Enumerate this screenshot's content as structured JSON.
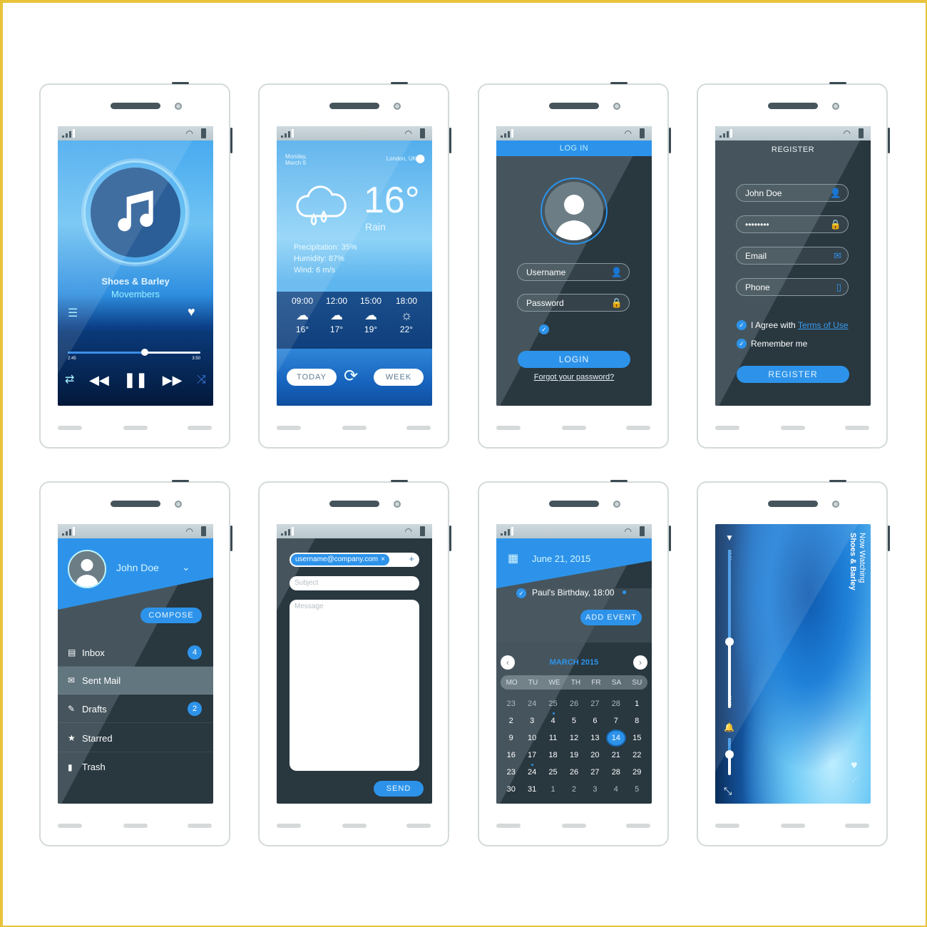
{
  "colors": {
    "accent": "#2d93ea",
    "dark_bg": "#29373f",
    "frame": "#e8c33a",
    "phone_border": "#d4dada"
  },
  "phones": {
    "music": {
      "track_title": "Shoes & Barley",
      "artist": "Movembers",
      "time_elapsed": "2:45",
      "time_total": "3:50",
      "progress_fraction": 0.58,
      "icons": [
        "music-note-icon",
        "menu-icon",
        "heart-icon",
        "repeat-icon",
        "rewind-icon",
        "pause-icon",
        "fast-forward-icon",
        "shuffle-icon"
      ]
    },
    "weather": {
      "date_line1": "Monday,",
      "date_line2": "March 9",
      "location": "London, UK",
      "temperature": "16°",
      "condition": "Rain",
      "precipitation": "Precipitation: 35%",
      "humidity": "Humidity: 87%",
      "wind": "Wind: 6 m/s",
      "forecast": [
        {
          "time": "09:00",
          "icon": "rain-cloud-icon",
          "temp": "16°"
        },
        {
          "time": "12:00",
          "icon": "rain-cloud-icon",
          "temp": "17°"
        },
        {
          "time": "15:00",
          "icon": "drizzle-cloud-icon",
          "temp": "19°"
        },
        {
          "time": "18:00",
          "icon": "sun-icon",
          "temp": "22°"
        }
      ],
      "today_label": "TODAY",
      "week_label": "WEEK"
    },
    "login": {
      "title": "LOG IN",
      "username_placeholder": "Username",
      "password_placeholder": "Password",
      "remember_checked": true,
      "login_label": "LOGIN",
      "forgot_label": "Forgot your password?"
    },
    "register": {
      "title": "REGISTER",
      "name_value": "John Doe",
      "password_value": "••••••••",
      "email_placeholder": "Email",
      "phone_placeholder": "Phone",
      "agree_prefix": "I Agree with ",
      "terms_link": "Terms of Use",
      "remember_label": "Remember me",
      "register_label": "REGISTER"
    },
    "mail": {
      "user_name": "John Doe",
      "compose_label": "COMPOSE",
      "items": [
        {
          "label": "Inbox",
          "icon": "inbox-icon",
          "glyph": "🖶",
          "badge": "4",
          "active": false
        },
        {
          "label": "Sent Mail",
          "icon": "envelope-icon",
          "glyph": "✉",
          "badge": "",
          "active": true
        },
        {
          "label": "Drafts",
          "icon": "paperclip-icon",
          "glyph": "✎",
          "badge": "2",
          "active": false
        },
        {
          "label": "Starred",
          "icon": "star-icon",
          "glyph": "★",
          "badge": "",
          "active": false
        },
        {
          "label": "Trash",
          "icon": "trash-icon",
          "glyph": "🗑",
          "badge": "",
          "active": false
        }
      ]
    },
    "compose": {
      "recipient": "username@company.com",
      "subject_placeholder": "Subject",
      "message_placeholder": "Message",
      "send_label": "SEND"
    },
    "calendar": {
      "date": "June 21, 2015",
      "event": "Paul's Birthday, 18:00",
      "add_event_label": "ADD EVENT",
      "month_label": "MARCH 2015",
      "weekdays": [
        "MO",
        "TU",
        "WE",
        "TH",
        "FR",
        "SA",
        "SU"
      ],
      "weeks": [
        [
          "23",
          "24",
          "25",
          "26",
          "27",
          "28",
          "1"
        ],
        [
          "2",
          "3",
          "4",
          "5",
          "6",
          "7",
          "8"
        ],
        [
          "9",
          "10",
          "11",
          "12",
          "13",
          "14",
          "15"
        ],
        [
          "16",
          "17",
          "18",
          "19",
          "20",
          "21",
          "22"
        ],
        [
          "23",
          "24",
          "25",
          "26",
          "27",
          "28",
          "29"
        ],
        [
          "30",
          "31",
          "1",
          "2",
          "3",
          "4",
          "5"
        ]
      ],
      "selected_day": "14",
      "marked_days": [
        "4",
        "24"
      ]
    },
    "video": {
      "now_label": "Now Watching",
      "title": "Shoes & Barley",
      "time_elapsed": "12:36",
      "time_total": "30:06",
      "progress_fraction": 0.58,
      "volume_fraction": 0.45
    }
  }
}
